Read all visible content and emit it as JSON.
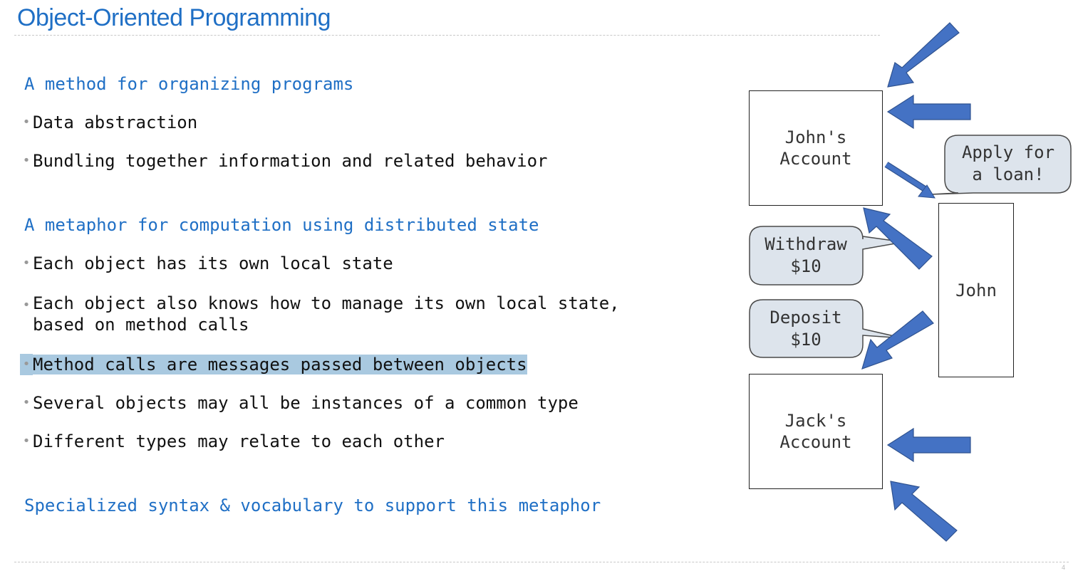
{
  "title": "Object-Oriented Programming",
  "sections": [
    {
      "heading": "A method for organizing programs",
      "bullets": [
        "Data abstraction",
        "Bundling together information and related behavior"
      ]
    },
    {
      "heading": "A metaphor for computation using distributed state",
      "bullets": [
        "Each object has its own local state",
        "Each object also knows how to manage its own local state,\nbased on method calls",
        "Method calls are messages passed between objects",
        "Several objects may all be instances of a common type",
        "Different types may relate to each other"
      ]
    },
    {
      "heading": "Specialized syntax & vocabulary to support this metaphor"
    }
  ],
  "diagram": {
    "johns_account": "John's\nAccount",
    "john": "John",
    "jacks_account": "Jack's\nAccount",
    "bubble_apply": "Apply for\na loan!",
    "bubble_withdraw": "Withdraw\n$10",
    "bubble_deposit": "Deposit\n$10"
  },
  "colors": {
    "title": "#1f6fc5",
    "arrow_fill": "#4472c4",
    "arrow_stroke": "#2f528f",
    "bubble_fill": "#dde4ec",
    "highlight": "#a9c9e0"
  },
  "page_number": "4"
}
